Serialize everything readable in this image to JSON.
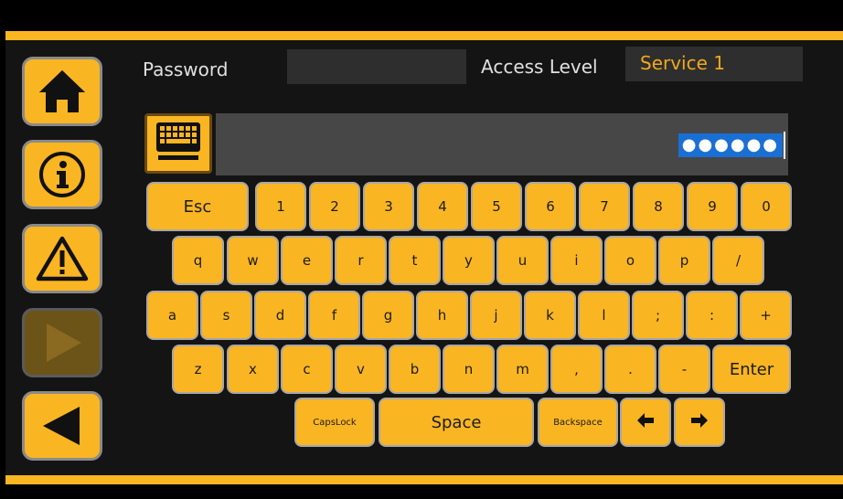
{
  "header": {
    "password_label": "Password",
    "password_value": "",
    "access_level_label": "Access Level",
    "access_level_value": "Service 1"
  },
  "entry": {
    "masked_value": "●●●●●●"
  },
  "sidebar": {
    "items": [
      {
        "name": "home-button",
        "icon": "home-icon",
        "enabled": true
      },
      {
        "name": "info-button",
        "icon": "info-icon",
        "enabled": true
      },
      {
        "name": "alarm-button",
        "icon": "warning-icon",
        "enabled": true
      },
      {
        "name": "forward-button",
        "icon": "play-icon",
        "enabled": false
      },
      {
        "name": "back-button",
        "icon": "left-triangle-icon",
        "enabled": true
      }
    ]
  },
  "keyboard": {
    "rows": [
      [
        "Esc",
        "1",
        "2",
        "3",
        "4",
        "5",
        "6",
        "7",
        "8",
        "9",
        "0"
      ],
      [
        "q",
        "w",
        "e",
        "r",
        "t",
        "y",
        "u",
        "i",
        "o",
        "p",
        "/"
      ],
      [
        "a",
        "s",
        "d",
        "f",
        "g",
        "h",
        "j",
        "k",
        "l",
        ";",
        ":",
        "+"
      ],
      [
        "z",
        "x",
        "c",
        "v",
        "b",
        "n",
        "m",
        ",",
        ".",
        "-",
        "Enter"
      ],
      [
        "CapsLock",
        "Space",
        "Backspace",
        "←",
        "→"
      ]
    ],
    "arrow_icons": [
      "left-arrow-icon",
      "right-arrow-icon"
    ]
  },
  "colors": {
    "accent": "#fab522",
    "accent_text": "#f0a91c",
    "selection": "#1a6fd4",
    "background": "#000000"
  }
}
